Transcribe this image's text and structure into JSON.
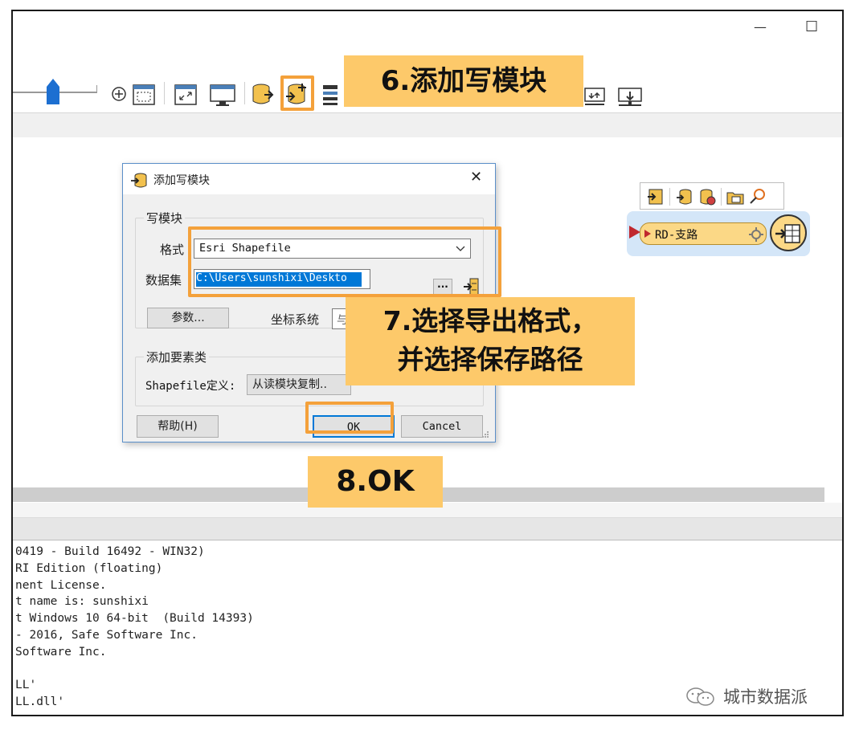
{
  "window": {
    "minimize_glyph": "—",
    "maximize_glyph": "☐"
  },
  "toolbar": {
    "icons": [
      "slider-thumb",
      "zoom-in-icon",
      "zoom-extent-icon",
      "fit-window-icon",
      "fit-screen-icon",
      "add-reader-icon",
      "add-writer-icon",
      "add-feature-type-icon",
      "import-icon",
      "export-icon"
    ],
    "callout_6": "6.添加写模块"
  },
  "dialog": {
    "title": "添加写模块",
    "close_glyph": "✕",
    "group_writer": "写模块",
    "format_label": "格式",
    "format_value": "Esri Shapefile",
    "dataset_label": "数据集",
    "dataset_value": "C:\\Users\\sunshixi\\Deskto",
    "browse_label": "···",
    "params_button": "参数...",
    "coord_label": "坐标系统",
    "coord_value": "与",
    "group_feature": "添加要素类",
    "shapefile_def_label": "Shapefile定义:",
    "shapefile_def_value": "从读模块复制..",
    "help_button": "帮助(H)",
    "ok_button": "OK",
    "cancel_button": "Cancel"
  },
  "callouts": {
    "step7_line1": "7.选择导出格式，",
    "step7_line2": "并选择保存路径",
    "step8": "8.OK"
  },
  "canvas": {
    "node_label": "RD-支路"
  },
  "log": {
    "lines": [
      "0419 - Build 16492 - WIN32)",
      "RI Edition (floating)",
      "nent License.",
      "t name is: sunshixi",
      "t Windows 10 64-bit  (Build 14393)",
      "- 2016, Safe Software Inc.",
      "Software Inc.",
      "",
      "LL'",
      "LL.dll'"
    ]
  },
  "watermark": "城市数据派",
  "colors": {
    "callout_fill": "#fdc96a",
    "highlight_border": "#f4a13b",
    "selection_blue": "#0078d7"
  }
}
